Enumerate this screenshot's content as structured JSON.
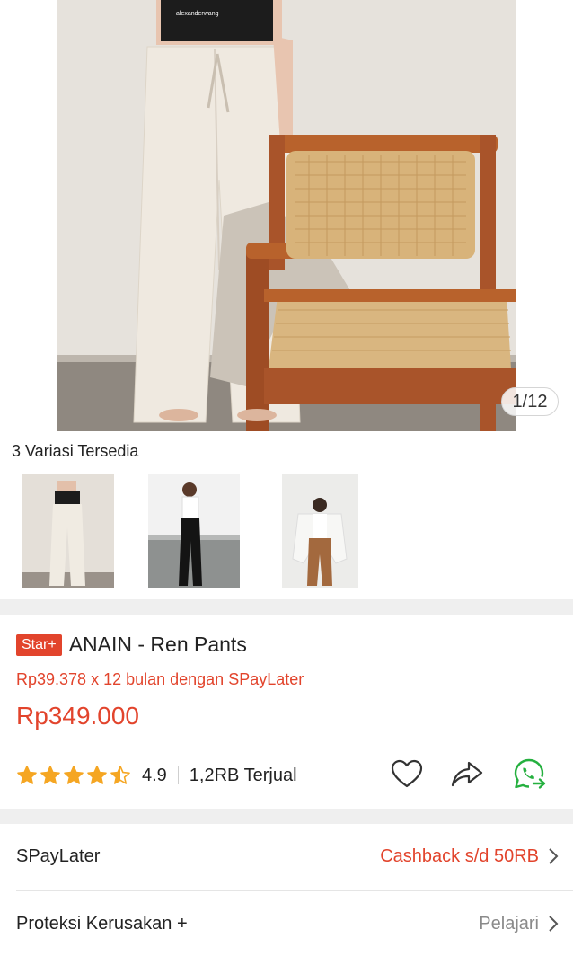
{
  "gallery": {
    "counter": "1/12",
    "shirt_brand": "alexanderwang"
  },
  "variants": {
    "label": "3 Variasi Tersedia"
  },
  "product": {
    "badge": "Star+",
    "title": "ANAIN - Ren Pants",
    "paylater_text": "Rp39.378 x 12 bulan dengan SPayLater",
    "price": "Rp349.000",
    "rating": 4.5,
    "rating_text": "4.9",
    "sold": "1,2RB Terjual"
  },
  "rows": {
    "spaylater": {
      "label": "SPayLater",
      "value": "Cashback s/d 50RB"
    },
    "protection": {
      "label": "Proteksi Kerusakan +",
      "value": "Pelajari"
    }
  },
  "colors": {
    "accent": "#e2442c",
    "star": "#f5a623",
    "whatsapp": "#25b03f"
  }
}
